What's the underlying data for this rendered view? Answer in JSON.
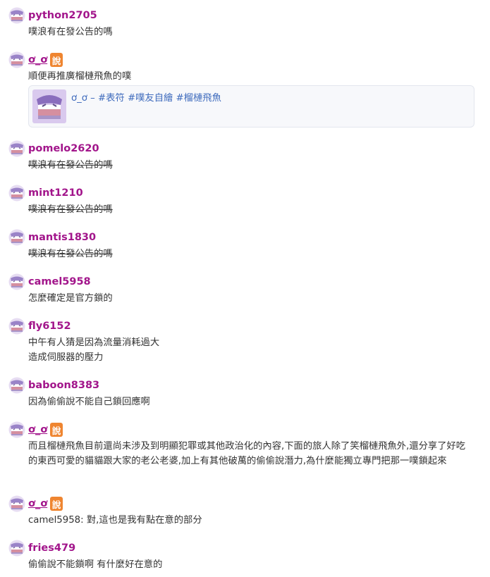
{
  "responses": [
    {
      "user": "python2705",
      "badge": "",
      "text": "噗浪有在發公告的嗎",
      "strike": false
    },
    {
      "user": "ơ_ơ",
      "badge": "說",
      "text": "順便再推廣榴槤飛魚的噗",
      "strike": false,
      "card": {
        "title": "ơ_ơ – #表符 #噗友自繪 #榴槤飛魚"
      }
    },
    {
      "user": "pomelo2620",
      "badge": "",
      "text": "噗浪有在發公告的嗎",
      "strike": true
    },
    {
      "user": "mint1210",
      "badge": "",
      "text": "噗浪有在發公告的嗎",
      "strike": true
    },
    {
      "user": "mantis1830",
      "badge": "",
      "text": "噗浪有在發公告的嗎",
      "strike": true
    },
    {
      "user": "camel5958",
      "badge": "",
      "text": "怎麼確定是官方鎖的",
      "strike": false
    },
    {
      "user": "fly6152",
      "badge": "",
      "text": "中午有人猜是因為流量消耗過大\n造成伺服器的壓力",
      "strike": false
    },
    {
      "user": "baboon8383",
      "badge": "",
      "text": "因為偷偷說不能自己鎖回應啊",
      "strike": false
    },
    {
      "user": "ơ_ơ",
      "badge": "說",
      "text": "而且榴槤飛魚目前還尚未涉及到明顯犯罪或其他政治化的內容,下面的旅人除了笑榴槤飛魚外,還分享了好吃的東西可愛的貓貓跟大家的老公老婆,加上有其他破萬的偷偷說潛力,為什麼能獨立專門把那一噗鎖起來",
      "strike": false
    },
    {
      "user": "ơ_ơ",
      "badge": "說",
      "text": "camel5958: 對,這也是我有點在意的部分",
      "strike": false
    },
    {
      "user": "fries479",
      "badge": "",
      "text": "偷偷說不能鎖啊 有什麼好在意的",
      "strike": false
    }
  ]
}
